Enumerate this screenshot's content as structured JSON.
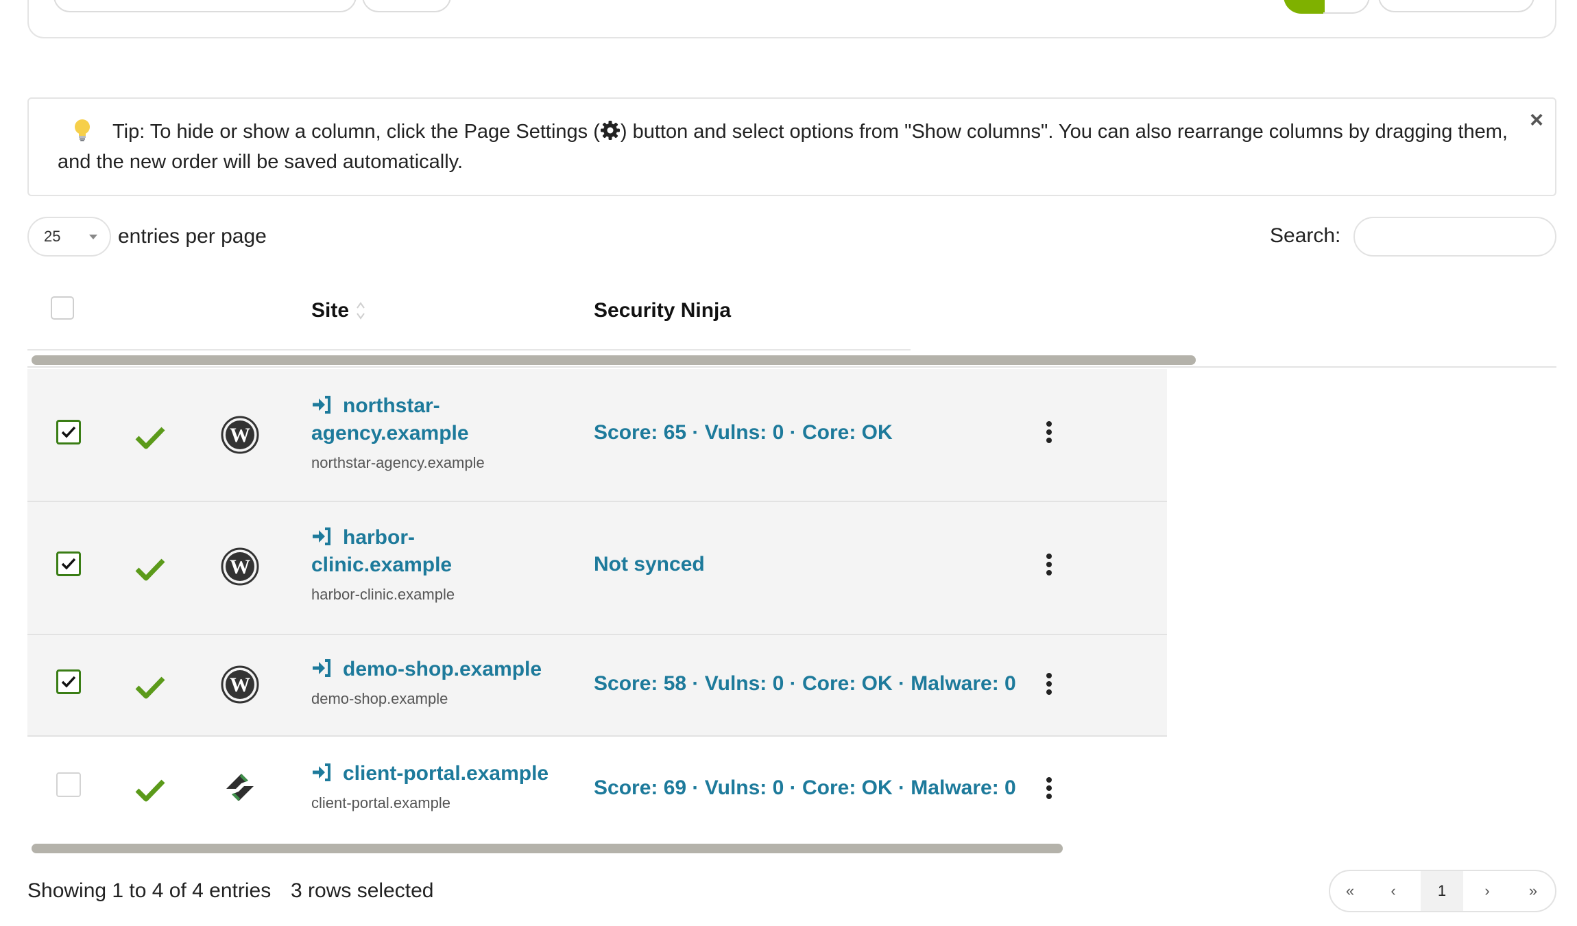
{
  "tip": {
    "before_gear": "Tip: To hide or show a column, click the Page Settings (",
    "after_gear": ") button and select options from \"Show columns\". You can also rearrange columns by dragging them, and the new order will be saved automatically.",
    "close": "×"
  },
  "length": {
    "value": "25",
    "label": "entries per page"
  },
  "search": {
    "label": "Search:",
    "value": ""
  },
  "columns": {
    "site": "Site",
    "security_ninja": "Security Ninja"
  },
  "rows": [
    {
      "selected": true,
      "name_line1": "northstar-",
      "name_line2": "agency.example",
      "url": "northstar-agency.example",
      "ninja": "Score: 65 · Vulns: 0 · Core: OK",
      "logo": "wordpress-logo-icon"
    },
    {
      "selected": true,
      "name_line1": "harbor-",
      "name_line2": "clinic.example",
      "url": "harbor-clinic.example",
      "ninja": "Not synced",
      "logo": "wordpress-logo-icon"
    },
    {
      "selected": true,
      "name_line1": "demo-shop.example",
      "name_line2": "",
      "url": "demo-shop.example",
      "ninja": "Score: 58 · Vulns: 0 · Core: OK · Malware: 0",
      "logo": "wordpress-logo-icon"
    },
    {
      "selected": false,
      "name_line1": "client-portal.example",
      "name_line2": "",
      "url": "client-portal.example",
      "ninja": "Score: 69 · Vulns: 0 · Core: OK · Malware: 0",
      "logo": "cms-logo-icon"
    }
  ],
  "footer": {
    "info": "Showing 1 to 4 of 4 entries",
    "selected": "3 rows selected"
  },
  "pagination": {
    "first": "«",
    "prev": "‹",
    "current": "1",
    "next": "›",
    "last": "»"
  },
  "colors": {
    "link": "#1d7a9b",
    "check": "#5b9a1a",
    "accent": "#7fb100"
  }
}
